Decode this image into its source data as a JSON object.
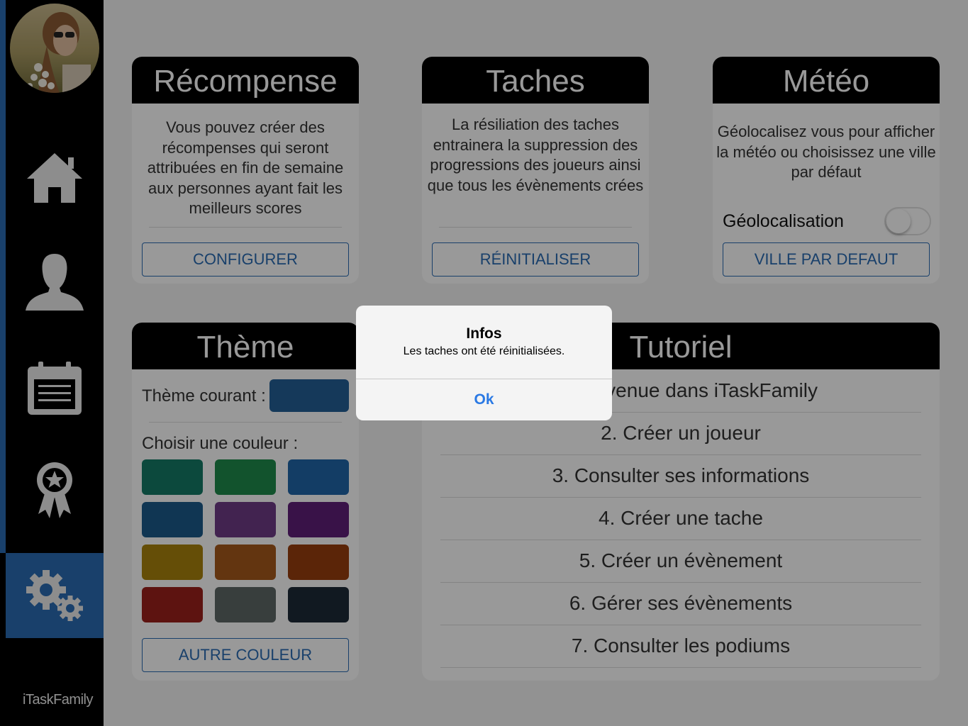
{
  "app": {
    "logo": "iTaskFamily"
  },
  "sidebar": {
    "items": [
      {
        "name": "home",
        "icon": "home-icon"
      },
      {
        "name": "player",
        "icon": "user-icon"
      },
      {
        "name": "calendar",
        "icon": "calendar-icon"
      },
      {
        "name": "awards",
        "icon": "award-icon"
      },
      {
        "name": "settings",
        "icon": "gear-icon",
        "active": true
      }
    ]
  },
  "recompense": {
    "title": "Récompense",
    "description": "Vous pouvez créer des récompenses qui seront attribuées en fin de semaine aux personnes ayant fait les meilleurs scores",
    "button": "CONFIGURER"
  },
  "taches": {
    "title": "Taches",
    "description": "La résiliation des taches entrainera la suppression des progressions des joueurs ainsi que tous les évènements crées",
    "button": "RÉINITIALISER"
  },
  "meteo": {
    "title": "Météo",
    "description": "Géolocalisez vous pour afficher la météo ou choisissez une ville par défaut",
    "geoloc_label": "Géolocalisation",
    "geoloc_on": false,
    "button": "VILLE PAR DEFAUT"
  },
  "theme": {
    "title": "Thème",
    "current_label": "Thème courant :",
    "current_color": "#235f96",
    "choose_label": "Choisir une couleur :",
    "colors": [
      "#147b67",
      "#1f8b4c",
      "#2166a8",
      "#1b5b8b",
      "#6e3b86",
      "#5f1f79",
      "#a8830d",
      "#a6591b",
      "#983f0e",
      "#9c211c",
      "#5e6866",
      "#1d2a38"
    ],
    "button": "AUTRE COULEUR"
  },
  "tutoriel": {
    "title": "Tutoriel",
    "items": [
      "1. Bienvenue dans iTaskFamily",
      "2. Créer un joueur",
      "3. Consulter ses informations",
      "4. Créer une tache",
      "5. Créer un évènement",
      "6. Gérer ses évènements",
      "7. Consulter les podiums"
    ]
  },
  "alert": {
    "title": "Infos",
    "message": "Les taches ont été réinitialisées.",
    "button": "Ok"
  }
}
